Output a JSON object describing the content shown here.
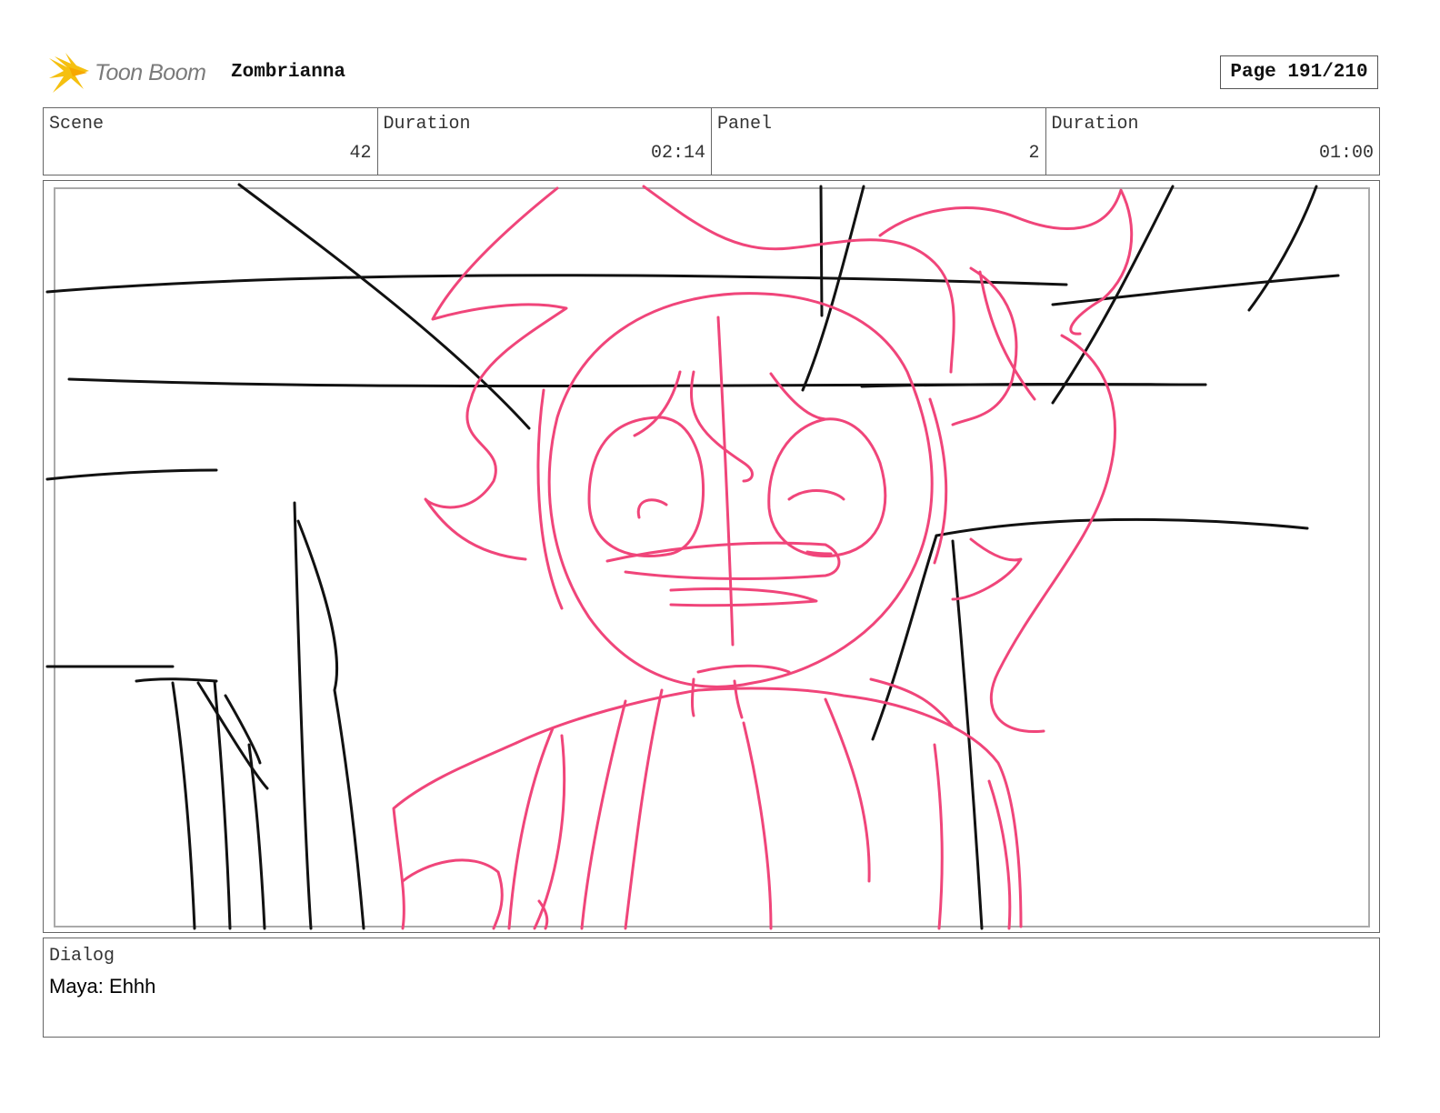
{
  "header": {
    "logo_text": "Toon Boom",
    "project_title": "Zombrianna",
    "page_label": "Page 191/210"
  },
  "info": [
    {
      "label": "Scene",
      "value": "42"
    },
    {
      "label": "Duration",
      "value": "02:14"
    },
    {
      "label": "Panel",
      "value": "2"
    },
    {
      "label": "Duration",
      "value": "01:00"
    }
  ],
  "dialog": {
    "label": "Dialog",
    "text": "Maya: Ehhh"
  },
  "colors": {
    "sketch_pink": "#f0457a",
    "line_black": "#111111",
    "logo_yellow": "#f5c010"
  },
  "icons": {
    "logo": "toon-boom-burst-icon"
  }
}
